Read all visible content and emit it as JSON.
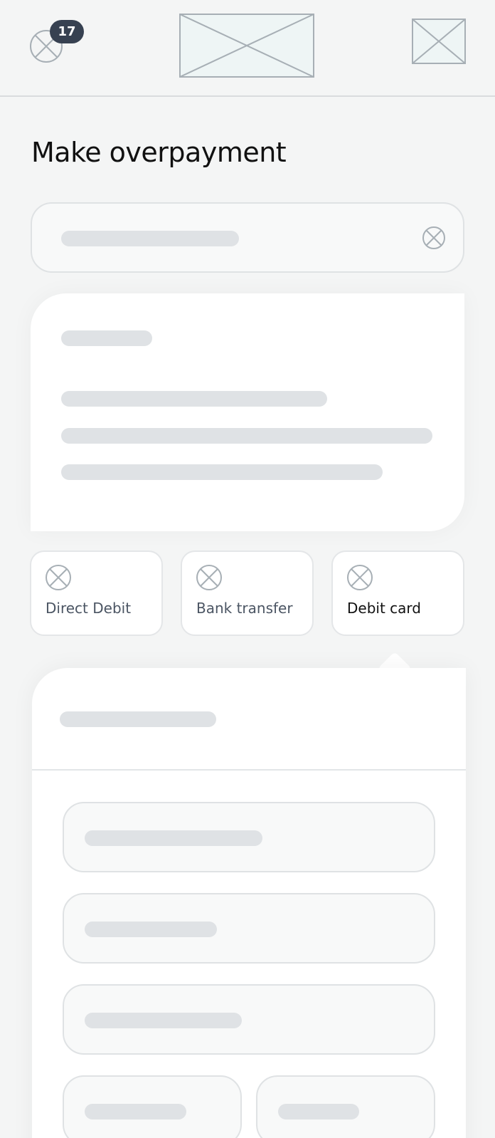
{
  "header": {
    "notification_count": "17",
    "left_icon": "close-circle-icon",
    "logo": "image-placeholder",
    "right_icon": "image-placeholder"
  },
  "page": {
    "title": "Make overpayment"
  },
  "payment_methods": [
    {
      "label": "Direct Debit",
      "icon": "close-circle-icon",
      "selected": false
    },
    {
      "label": "Bank transfer",
      "icon": "close-circle-icon",
      "selected": false
    },
    {
      "label": "Debit card",
      "icon": "close-circle-icon",
      "selected": true
    }
  ],
  "colors": {
    "background": "#f4f5f5",
    "card": "#ffffff",
    "skeleton": "#dfe2e5",
    "badge": "#374151",
    "icon_stroke": "#a7afb5"
  }
}
